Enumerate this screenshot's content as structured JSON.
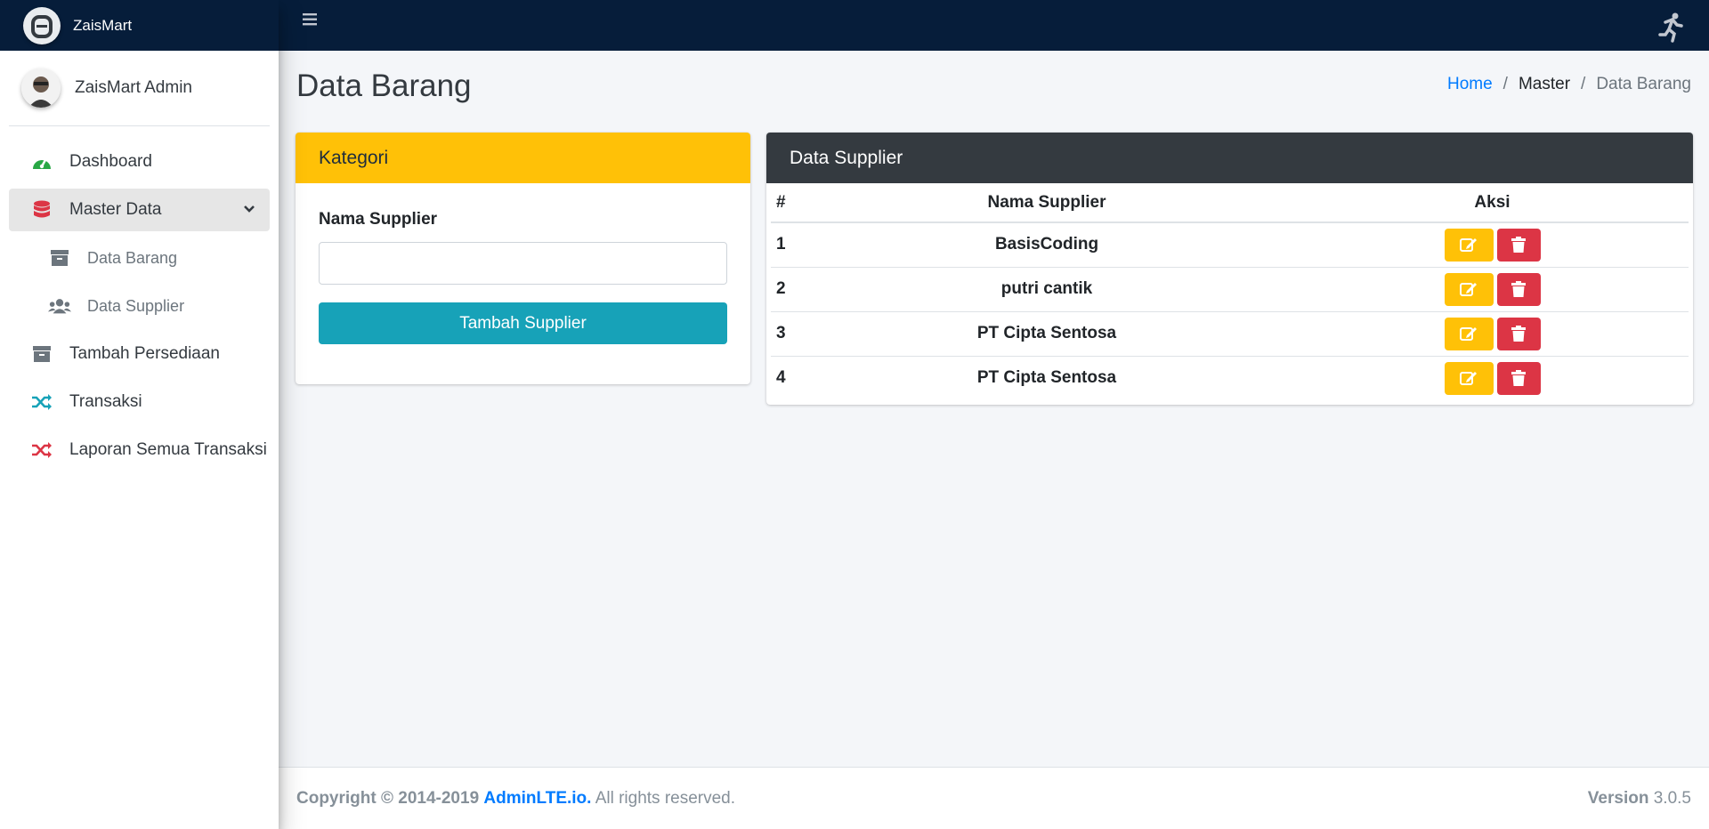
{
  "brand": {
    "name": "ZaisMart"
  },
  "user": {
    "name": "ZaisMart Admin"
  },
  "sidebar": {
    "items": [
      {
        "label": "Dashboard",
        "icon": "tachometer-icon",
        "color": "#28a745"
      },
      {
        "label": "Master Data",
        "icon": "database-icon",
        "color": "#dc3545"
      },
      {
        "label": "Data Barang",
        "icon": "archive-icon",
        "color": "#6c757d"
      },
      {
        "label": "Data Supplier",
        "icon": "users-icon",
        "color": "#6c757d"
      },
      {
        "label": "Tambah Persediaan",
        "icon": "archive-icon",
        "color": "#6c757d"
      },
      {
        "label": "Transaksi",
        "icon": "random-icon",
        "color": "#17a2b8"
      },
      {
        "label": "Laporan Semua Transaksi",
        "icon": "random-icon",
        "color": "#dc3545"
      }
    ]
  },
  "page": {
    "title": "Data Barang",
    "breadcrumb": {
      "home": "Home",
      "sep1": "/",
      "master": "Master",
      "sep2": "/",
      "current": "Data Barang"
    }
  },
  "form_card": {
    "header": "Kategori",
    "label": "Nama Supplier",
    "input_value": "",
    "button": "Tambah Supplier"
  },
  "table_card": {
    "header": "Data Supplier",
    "columns": [
      "#",
      "Nama Supplier",
      "Aksi"
    ],
    "rows": [
      {
        "no": "1",
        "name": "BasisCoding"
      },
      {
        "no": "2",
        "name": "putri cantik"
      },
      {
        "no": "3",
        "name": "PT Cipta Sentosa"
      },
      {
        "no": "4",
        "name": "PT Cipta Sentosa"
      }
    ]
  },
  "footer": {
    "copyright": "Copyright © 2014-2019",
    "brand": "AdminLTE.io.",
    "rights": "All rights reserved.",
    "version_label": "Version",
    "version": "3.0.5"
  },
  "colors": {
    "navbar": "#061d3a",
    "warning": "#ffc107",
    "danger": "#dc3545",
    "info": "#17a2b8",
    "dark": "#343a40"
  }
}
